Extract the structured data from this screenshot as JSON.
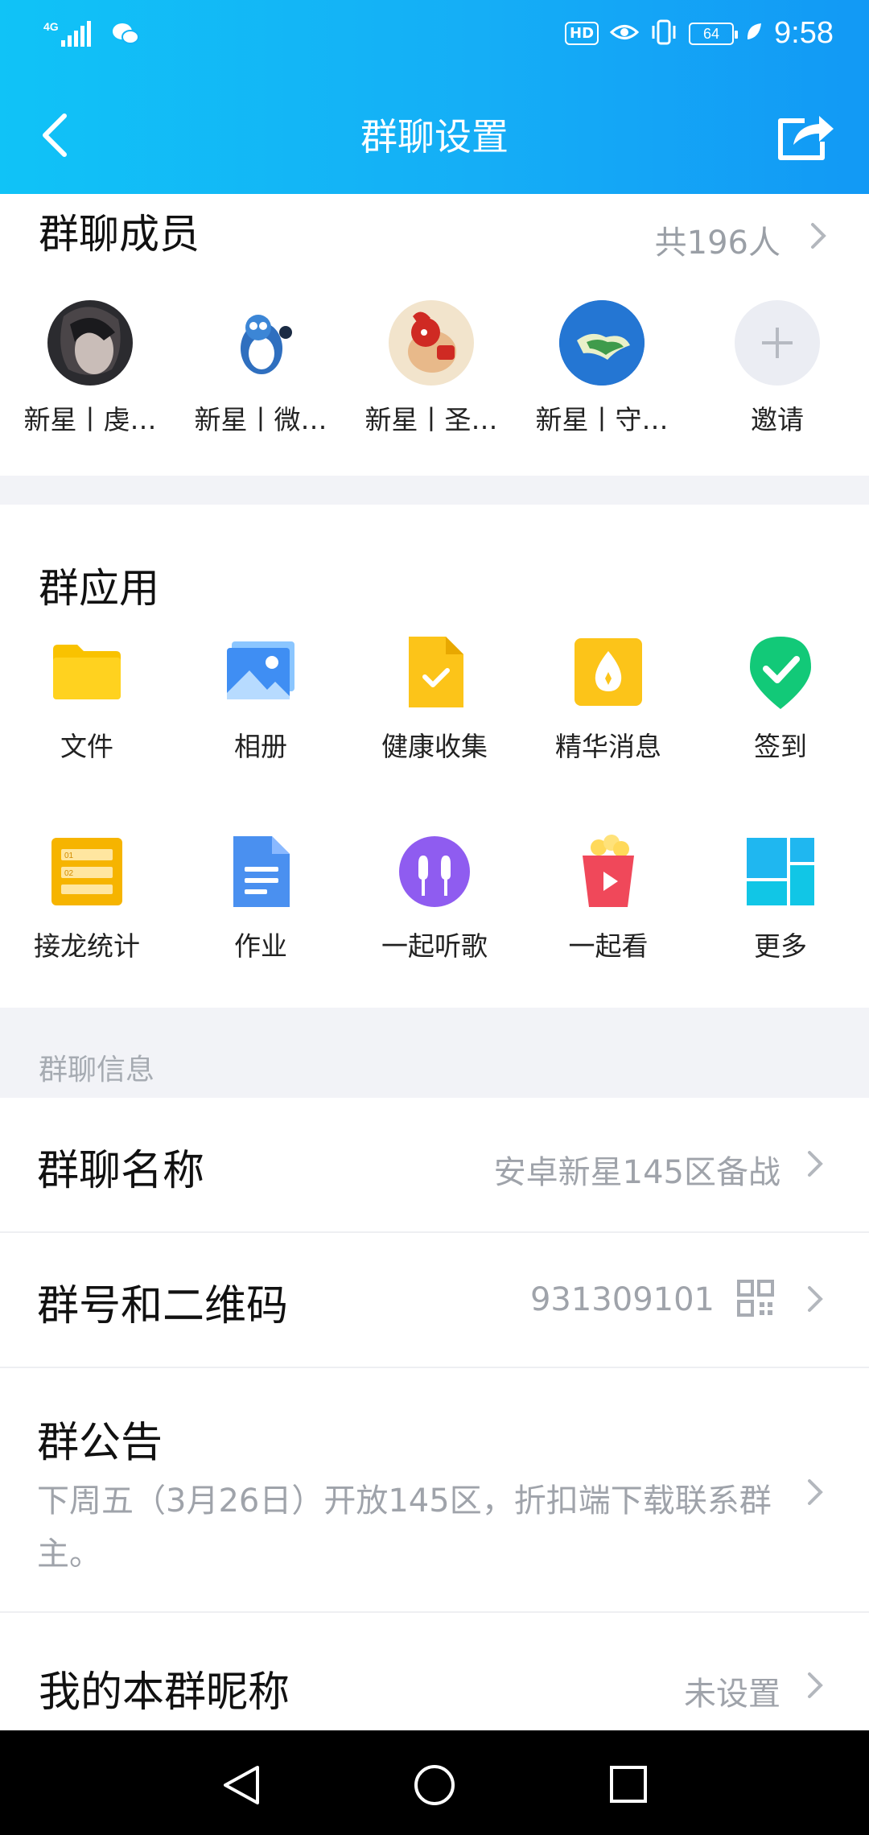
{
  "status": {
    "network": "4G",
    "battery": "64",
    "time": "9:58",
    "hd": "HD"
  },
  "header": {
    "title": "群聊设置"
  },
  "members": {
    "title": "群聊成员",
    "count": "共196人",
    "items": [
      {
        "name": "新星丨虔…"
      },
      {
        "name": "新星丨微…"
      },
      {
        "name": "新星丨圣…"
      },
      {
        "name": "新星丨守…"
      },
      {
        "name": "邀请"
      }
    ]
  },
  "apps": {
    "title": "群应用",
    "items": [
      {
        "label": "文件",
        "icon": "folder-icon"
      },
      {
        "label": "相册",
        "icon": "photo-album-icon"
      },
      {
        "label": "健康收集",
        "icon": "health-check-icon"
      },
      {
        "label": "精华消息",
        "icon": "essence-message-icon"
      },
      {
        "label": "签到",
        "icon": "checkin-icon"
      },
      {
        "label": "接龙统计",
        "icon": "relay-stats-icon"
      },
      {
        "label": "作业",
        "icon": "homework-icon"
      },
      {
        "label": "一起听歌",
        "icon": "listen-together-icon"
      },
      {
        "label": "一起看",
        "icon": "watch-together-icon"
      },
      {
        "label": "更多",
        "icon": "more-grid-icon"
      }
    ]
  },
  "info": {
    "section_label": "群聊信息",
    "name_label": "群聊名称",
    "name_value": "安卓新星145区备战",
    "number_label": "群号和二维码",
    "number_value": "931309101",
    "notice_label": "群公告",
    "notice_text": "下周五（3月26日）开放145区，折扣端下载联系群主。",
    "nickname_label": "我的本群昵称",
    "nickname_value": "未设置"
  },
  "colors": {
    "header_start": "#10c3f7",
    "header_end": "#1299f5",
    "muted": "#9fa3aa",
    "bg_gap": "#f2f3f7"
  }
}
